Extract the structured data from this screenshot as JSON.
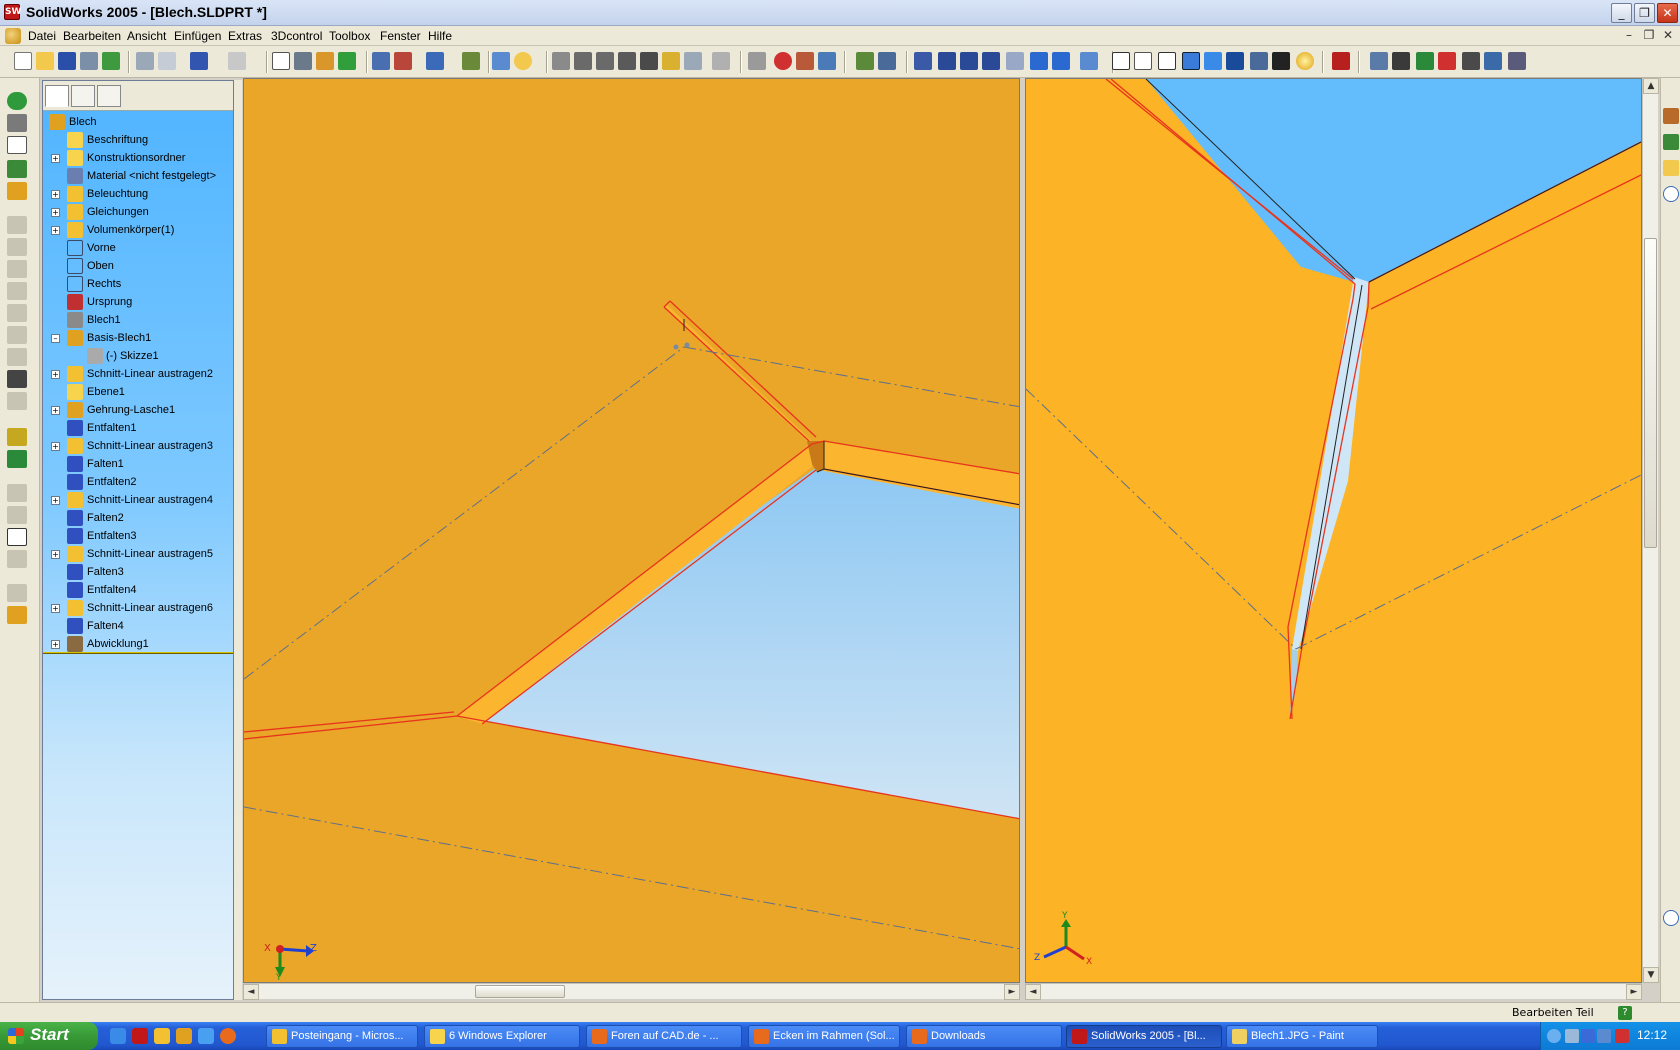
{
  "window": {
    "title": "SolidWorks 2005 - [Blech.SLDPRT *]",
    "app_icon": "SW",
    "minimize": "_",
    "restore": "❐",
    "close": "✕"
  },
  "menubar": {
    "items": [
      "Datei",
      "Bearbeiten",
      "Ansicht",
      "Einfügen",
      "Extras",
      "3Dcontrol",
      "Toolbox",
      "Fenster",
      "Hilfe"
    ],
    "mdi_controls": [
      "–",
      "❐",
      "✕"
    ]
  },
  "feature_tree": {
    "root": "Blech",
    "items": [
      {
        "label": "Beschriftung",
        "expand": "",
        "icon": "annotation-icon",
        "color": "#f7d44c"
      },
      {
        "label": "Konstruktionsordner",
        "expand": "+",
        "icon": "folder-icon",
        "color": "#f7d44c"
      },
      {
        "label": "Material <nicht festgelegt>",
        "expand": "",
        "icon": "material-icon",
        "color": "#6a7fb0"
      },
      {
        "label": "Beleuchtung",
        "expand": "+",
        "icon": "lighting-icon",
        "color": "#f2c030"
      },
      {
        "label": "Gleichungen",
        "expand": "+",
        "icon": "equations-icon",
        "color": "#f2c030"
      },
      {
        "label": "Volumenkörper(1)",
        "expand": "+",
        "icon": "solid-bodies-icon",
        "color": "#f2c030"
      },
      {
        "label": "Vorne",
        "expand": "",
        "icon": "plane-icon",
        "color": ""
      },
      {
        "label": "Oben",
        "expand": "",
        "icon": "plane-icon",
        "color": ""
      },
      {
        "label": "Rechts",
        "expand": "",
        "icon": "plane-icon",
        "color": ""
      },
      {
        "label": "Ursprung",
        "expand": "",
        "icon": "origin-icon",
        "color": "#c03030"
      },
      {
        "label": "Blech1",
        "expand": "",
        "icon": "sheet-metal-icon",
        "color": "#8a8a8a"
      },
      {
        "label": "Basis-Blech1",
        "expand": "–",
        "icon": "base-flange-icon",
        "color": "#e0a020"
      },
      {
        "label": "(-) Skizze1",
        "expand": "",
        "icon": "sketch-icon",
        "color": "#aaaaaa",
        "indent": true
      },
      {
        "label": "Schnitt-Linear austragen2",
        "expand": "+",
        "icon": "cut-extrude-icon",
        "color": "#f2c030"
      },
      {
        "label": "Ebene1",
        "expand": "",
        "icon": "plane-icon",
        "color": "#f7d44c"
      },
      {
        "label": "Gehrung-Lasche1",
        "expand": "+",
        "icon": "miter-flange-icon",
        "color": "#e0a020"
      },
      {
        "label": "Entfalten1",
        "expand": "",
        "icon": "unfold-icon",
        "color": "#3050c0"
      },
      {
        "label": "Schnitt-Linear austragen3",
        "expand": "+",
        "icon": "cut-extrude-icon",
        "color": "#f2c030"
      },
      {
        "label": "Falten1",
        "expand": "",
        "icon": "fold-icon",
        "color": "#3050c0"
      },
      {
        "label": "Entfalten2",
        "expand": "",
        "icon": "unfold-icon",
        "color": "#3050c0"
      },
      {
        "label": "Schnitt-Linear austragen4",
        "expand": "+",
        "icon": "cut-extrude-icon",
        "color": "#f2c030"
      },
      {
        "label": "Falten2",
        "expand": "",
        "icon": "fold-icon",
        "color": "#3050c0"
      },
      {
        "label": "Entfalten3",
        "expand": "",
        "icon": "unfold-icon",
        "color": "#3050c0"
      },
      {
        "label": "Schnitt-Linear austragen5",
        "expand": "+",
        "icon": "cut-extrude-icon",
        "color": "#f2c030"
      },
      {
        "label": "Falten3",
        "expand": "",
        "icon": "fold-icon",
        "color": "#3050c0"
      },
      {
        "label": "Entfalten4",
        "expand": "",
        "icon": "unfold-icon",
        "color": "#3050c0"
      },
      {
        "label": "Schnitt-Linear austragen6",
        "expand": "+",
        "icon": "cut-extrude-icon",
        "color": "#f2c030"
      },
      {
        "label": "Falten4",
        "expand": "",
        "icon": "fold-icon",
        "color": "#3050c0"
      },
      {
        "label": "Abwicklung1",
        "expand": "+",
        "icon": "flat-pattern-icon",
        "color": "#8a6a40"
      }
    ]
  },
  "viewports": {
    "left": {
      "triad": [
        "Y",
        "X",
        "Z"
      ]
    },
    "right": {
      "triad": [
        "Y",
        "Z",
        "X"
      ]
    },
    "colors": {
      "part": "#fcb325",
      "part_dark": "#e9a628",
      "edge": "#e8341c",
      "background_top": "#63bdfc",
      "background_bottom": "#c8e2f3"
    }
  },
  "status": {
    "text": "Bearbeiten Teil",
    "help": "?"
  },
  "taskbar": {
    "start": "Start",
    "tasks": [
      {
        "label": "Posteingang - Micros...",
        "icon": "outlook-icon",
        "color": "#f2c030"
      },
      {
        "label": "6 Windows Explorer",
        "icon": "explorer-folder-icon",
        "color": "#f7d44c"
      },
      {
        "label": "Foren auf CAD.de - ...",
        "icon": "firefox-icon",
        "color": "#e86a1c"
      },
      {
        "label": "Ecken im Rahmen (Sol...",
        "icon": "firefox-icon",
        "color": "#e86a1c"
      },
      {
        "label": "Downloads",
        "icon": "firefox-icon",
        "color": "#e86a1c"
      },
      {
        "label": "SolidWorks 2005 - [Bl...",
        "icon": "solidworks-icon",
        "color": "#c01818",
        "active": true
      },
      {
        "label": "Blech1.JPG - Paint",
        "icon": "paint-icon",
        "color": "#f0d060"
      }
    ],
    "clock": "12:12"
  }
}
